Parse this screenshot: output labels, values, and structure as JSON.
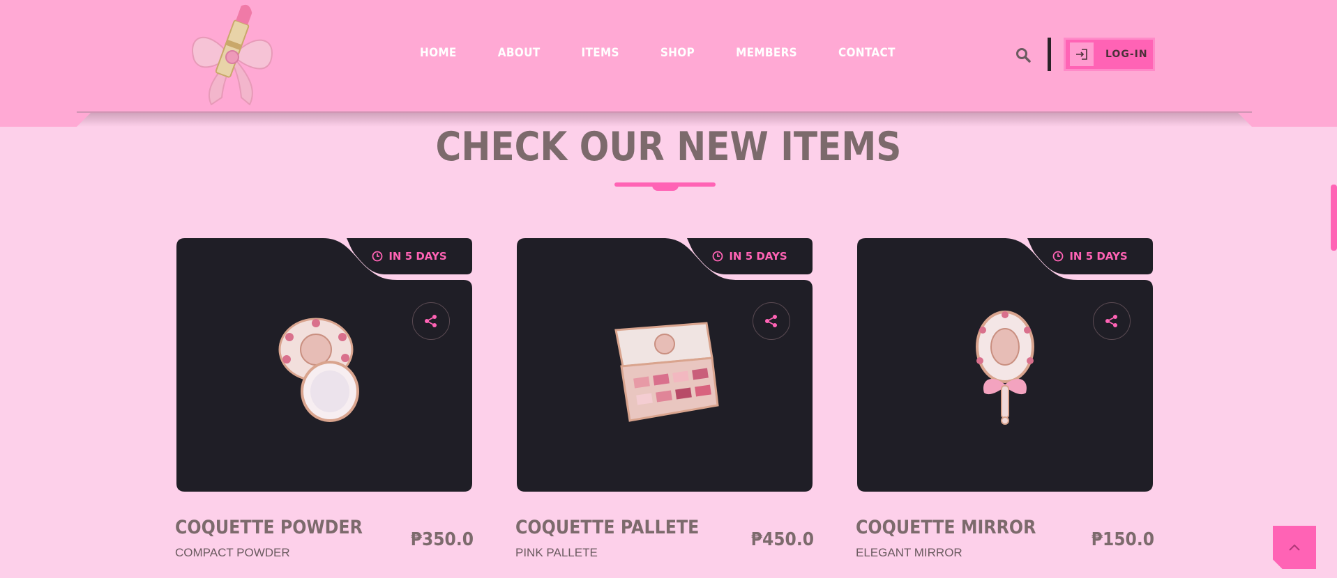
{
  "nav": {
    "items": [
      "HOME",
      "ABOUT",
      "ITEMS",
      "SHOP",
      "MEMBERS",
      "CONTACT"
    ],
    "login_label": "LOG-IN"
  },
  "icons": {
    "logo": "bow-lipstick-logo",
    "search": "search-icon",
    "login": "login-icon",
    "clock": "clock-icon",
    "share": "share-icon",
    "scroll_top": "chevron-up-icon"
  },
  "section": {
    "title": "CHECK OUR NEW ITEMS"
  },
  "products": [
    {
      "badge": "IN 5 DAYS",
      "name": "COQUETTE POWDER",
      "subtitle": "COMPACT POWDER",
      "price": "₱350.0"
    },
    {
      "badge": "IN 5 DAYS",
      "name": "COQUETTE PALLETE",
      "subtitle": "PINK PALLETE",
      "price": "₱450.0"
    },
    {
      "badge": "IN 5 DAYS",
      "name": "COQUETTE MIRROR",
      "subtitle": "ELEGANT MIRROR",
      "price": "₱150.0"
    }
  ],
  "colors": {
    "header": "#ffa9d4",
    "background": "#fdd0ea",
    "accent": "#ff63b5",
    "card": "#1f1e26",
    "text": "#7c6a6c"
  }
}
